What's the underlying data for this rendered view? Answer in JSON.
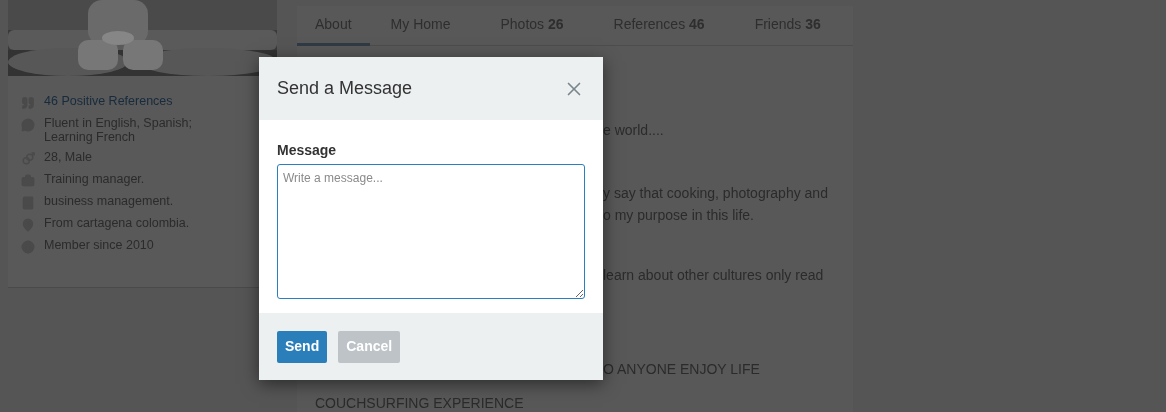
{
  "sidebar": {
    "items": [
      {
        "text": "46 Positive References",
        "kind": "link"
      },
      {
        "text": "Fluent in English, Spanish; Learning French",
        "kind": "text"
      },
      {
        "text": "28, Male",
        "kind": "text"
      },
      {
        "text": "Training manager.",
        "kind": "text"
      },
      {
        "text": "business management.",
        "kind": "text"
      },
      {
        "text": "From cartagena colombia.",
        "kind": "text"
      },
      {
        "text": "Member since 2010",
        "kind": "text"
      }
    ]
  },
  "tabs": [
    {
      "label": "About",
      "selected": true
    },
    {
      "label": "My Home",
      "selected": false
    },
    {
      "label": "Photos",
      "count": "26",
      "selected": false
    },
    {
      "label": "References",
      "count": "46",
      "selected": false
    },
    {
      "label": "Friends",
      "count": "36",
      "selected": false
    }
  ],
  "about": [
    {
      "text": "e world....",
      "kind": "fragment"
    },
    {
      "text": "y say that cooking, photography and",
      "kind": "fragment"
    },
    {
      "text": "o my purpose in this life.",
      "kind": "fragment"
    },
    {
      "text": "learn about other cultures only read",
      "kind": "fragment"
    },
    {
      "text": "O ANYONE ENJOY LIFE",
      "kind": "fragment"
    },
    {
      "text": "COUCHSURFING EXPERIENCE",
      "kind": "heading"
    }
  ],
  "dialog": {
    "title": "Send a Message",
    "field_label": "Message",
    "placeholder": "Write a message...",
    "buttons": [
      {
        "label": "Send",
        "kind": "primary",
        "disabled": false
      },
      {
        "label": "Cancel",
        "kind": "secondary",
        "disabled": true
      }
    ]
  }
}
